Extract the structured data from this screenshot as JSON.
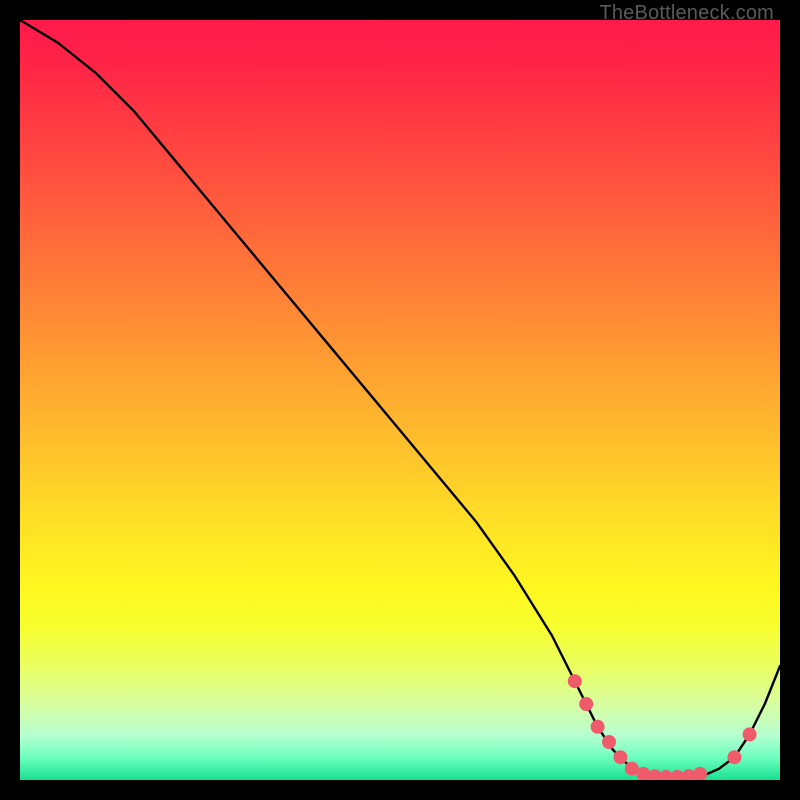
{
  "watermark": "TheBottleneck.com",
  "chart_data": {
    "type": "line",
    "title": "",
    "xlabel": "",
    "ylabel": "",
    "xlim": [
      0,
      100
    ],
    "ylim": [
      0,
      100
    ],
    "series": [
      {
        "name": "curve",
        "x": [
          0,
          5,
          10,
          15,
          20,
          25,
          30,
          35,
          40,
          45,
          50,
          55,
          60,
          65,
          70,
          72,
          74,
          76,
          78,
          80,
          82,
          84,
          86,
          88,
          90,
          92,
          94,
          96,
          98,
          100
        ],
        "y": [
          100,
          97,
          93,
          88,
          82,
          76,
          70,
          64,
          58,
          52,
          46,
          40,
          34,
          27,
          19,
          15,
          11,
          7,
          4,
          2,
          1,
          0.5,
          0.4,
          0.4,
          0.6,
          1.5,
          3,
          6,
          10,
          15
        ]
      }
    ],
    "markers": [
      {
        "x": 73,
        "y": 13
      },
      {
        "x": 74.5,
        "y": 10
      },
      {
        "x": 76,
        "y": 7
      },
      {
        "x": 77.5,
        "y": 5
      },
      {
        "x": 79,
        "y": 3
      },
      {
        "x": 80.5,
        "y": 1.5
      },
      {
        "x": 82,
        "y": 0.8
      },
      {
        "x": 83.5,
        "y": 0.5
      },
      {
        "x": 85,
        "y": 0.4
      },
      {
        "x": 86.5,
        "y": 0.4
      },
      {
        "x": 88,
        "y": 0.5
      },
      {
        "x": 89.5,
        "y": 0.8
      },
      {
        "x": 94,
        "y": 3
      },
      {
        "x": 96,
        "y": 6
      }
    ],
    "marker_style": {
      "color": "#ef5b6a",
      "radius_px": 7
    }
  }
}
